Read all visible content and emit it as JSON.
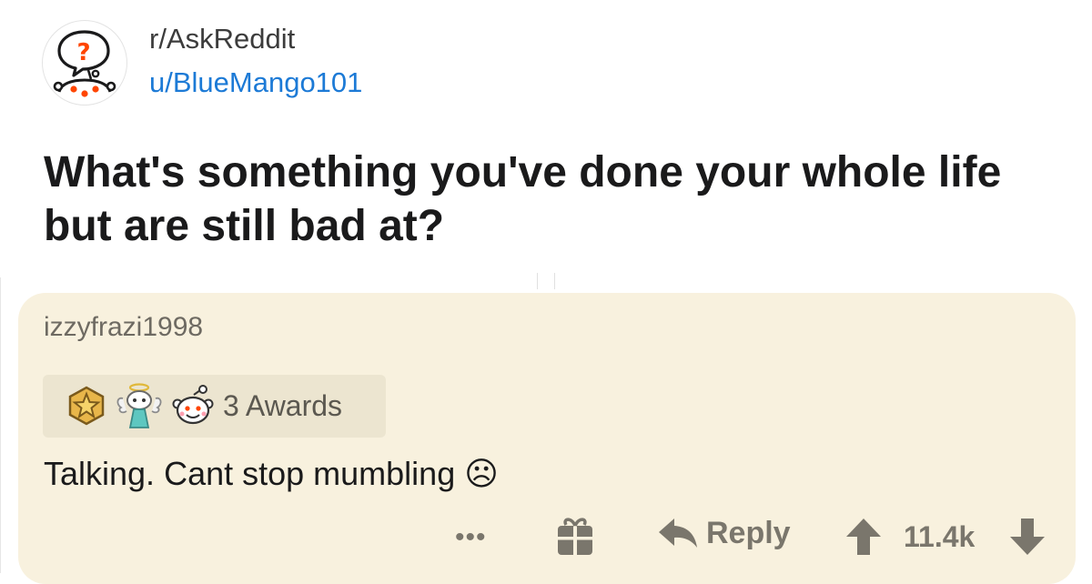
{
  "post": {
    "subreddit": "r/AskReddit",
    "author": "u/BlueMango101",
    "title": "What's something you've done your whole life but are still bad at?",
    "subreddit_icon": "askreddit-snoo-icon"
  },
  "comment": {
    "author": "izzyfrazi1998",
    "awards_label": "3 Awards",
    "award_icons": [
      "gold-award-icon",
      "angel-award-icon",
      "wholesome-award-icon"
    ],
    "body": "Talking. Cant stop mumbling ☹",
    "actions": {
      "more_label": "•••",
      "gift_icon": "gift-icon",
      "reply_label": "Reply",
      "score": "11.4k"
    }
  },
  "colors": {
    "accent_link": "#1c7ad6",
    "comment_bg": "#f8f1de",
    "awards_bg": "#ece5d0",
    "action_gray": "#7a766c",
    "snoo_orange": "#ff4500"
  }
}
